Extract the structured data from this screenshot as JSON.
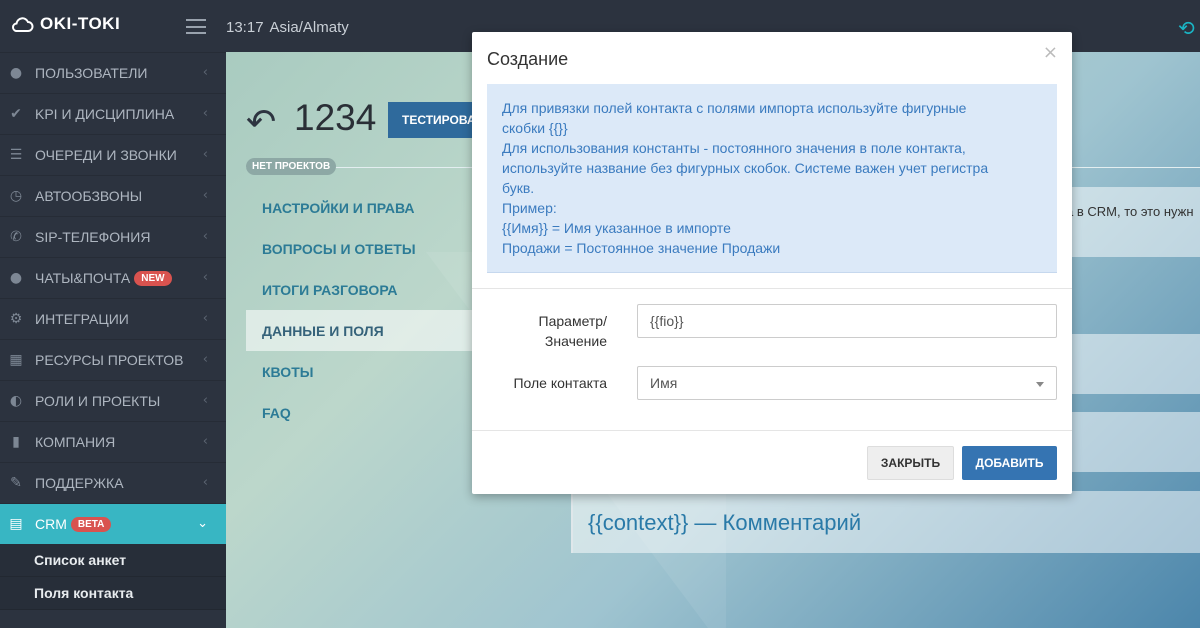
{
  "topbar": {
    "logo": "OKI-TOKI",
    "time": "13:17",
    "timezone": "Asia/Almaty"
  },
  "sidebar": {
    "items": [
      {
        "label": "ПОЛЬЗОВАТЕЛИ",
        "icon": "user-icon"
      },
      {
        "label": "KPI И ДИСЦИПЛИНА",
        "icon": "check-icon"
      },
      {
        "label": "ОЧЕРЕДИ И ЗВОНКИ",
        "icon": "list-icon"
      },
      {
        "label": "АВТООБЗВОНЫ",
        "icon": "clock-icon"
      },
      {
        "label": "SIP-ТЕЛЕФОНИЯ",
        "icon": "phone-icon"
      },
      {
        "label": "ЧАТЫ&ПОЧТА",
        "icon": "chat-icon",
        "badge": "NEW"
      },
      {
        "label": "ИНТЕГРАЦИИ",
        "icon": "cogs-icon"
      },
      {
        "label": "РЕСУРСЫ ПРОЕКТОВ",
        "icon": "grid-icon"
      },
      {
        "label": "РОЛИ И ПРОЕКТЫ",
        "icon": "toggle-icon"
      },
      {
        "label": "КОМПАНИЯ",
        "icon": "bar-chart-icon"
      },
      {
        "label": "ПОДДЕРЖКА",
        "icon": "wrench-icon"
      },
      {
        "label": "CRM",
        "icon": "crm-icon",
        "badge": "BETA"
      }
    ],
    "subitems": [
      "Список анкет",
      "Поля контакта"
    ]
  },
  "page": {
    "title": "1234",
    "test_button": "ТЕСТИРОВАТЬ",
    "no_projects": "НЕТ ПРОЕКТОВ",
    "tabs": [
      "НАСТРОЙКИ И ПРАВА",
      "ВОПРОСЫ И ОТВЕТЫ",
      "ИТОГИ РАЗГОВОРА",
      "ДАННЫЕ И ПОЛЯ",
      "КВОТЫ",
      "FAQ"
    ],
    "partial_text": "а в CRM, то это нужн",
    "context_text": "{{context}} — Комментарий"
  },
  "modal": {
    "title": "Создание",
    "info_lines": [
      "Для привязки полей контакта с полями импорта используйте фигурные",
      "скобки {{}}",
      "Для использования константы - постоянного значения в поле контакта,",
      "используйте название без фигурных скобок. Системе важен учет регистра",
      "букв.",
      "Пример:",
      "{{Имя}} = Имя указанное в импорте",
      "Продажи = Постоянное значение Продажи"
    ],
    "param_label_1": "Параметр/",
    "param_label_2": "Значение",
    "param_value": "{{fio}}",
    "contact_field_label": "Поле контакта",
    "contact_field_value": "Имя",
    "close_button": "ЗАКРЫТЬ",
    "add_button": "ДОБАВИТЬ"
  },
  "colors": {
    "sidebar_bg": "#2c333f",
    "active": "#38b6c3",
    "primary": "#3574b2",
    "badge": "#d9534f"
  }
}
